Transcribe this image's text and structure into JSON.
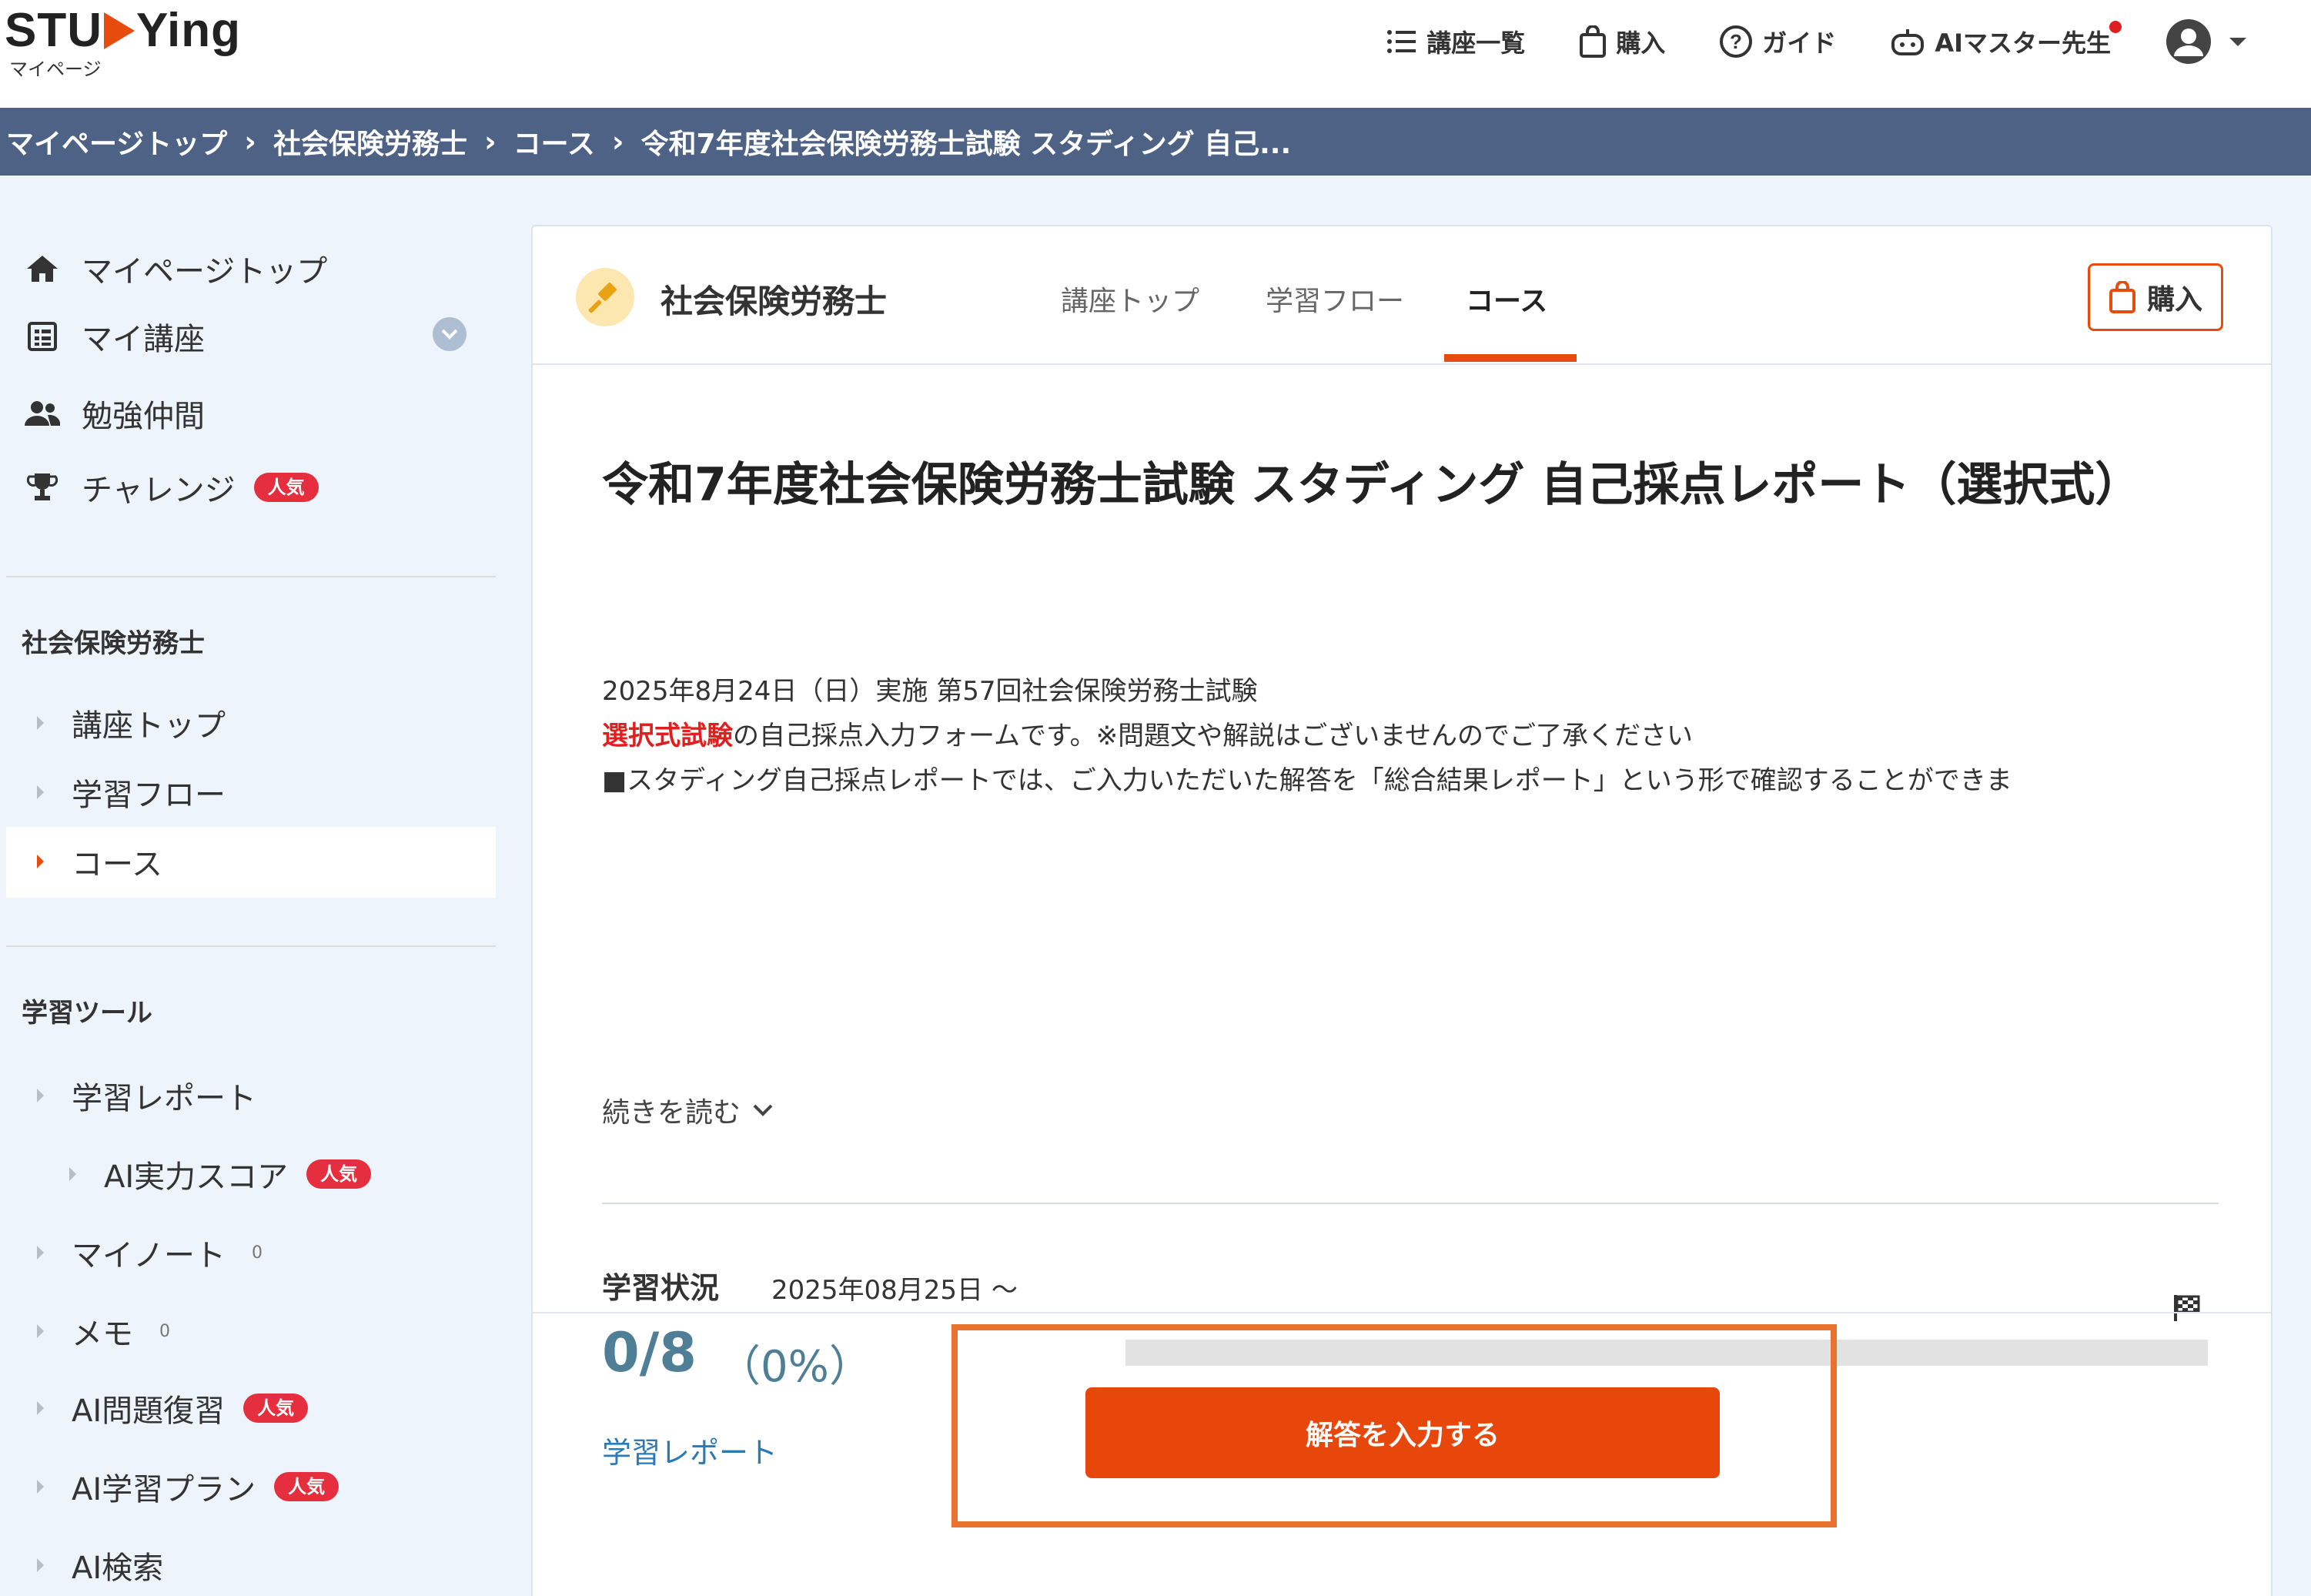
{
  "header": {
    "logo_text_left": "STU",
    "logo_text_right": "Ying",
    "logo_sub": "マイページ",
    "nav": [
      {
        "label": "講座一覧",
        "icon": "list-icon"
      },
      {
        "label": "購入",
        "icon": "shopping-bag-icon"
      },
      {
        "label": "ガイド",
        "icon": "help-circle-icon"
      },
      {
        "label": "AIマスター先生",
        "icon": "robot-icon"
      }
    ]
  },
  "breadcrumb": [
    "マイページトップ",
    "社会保険労務士",
    "コース",
    "令和7年度社会保険労務士試験 スタディング 自己..."
  ],
  "sidebar": {
    "top_items": [
      {
        "label": "マイページトップ",
        "icon": "home-icon"
      },
      {
        "label": "マイ講座",
        "icon": "book-icon"
      },
      {
        "label": "勉強仲間",
        "icon": "people-icon"
      },
      {
        "label": "チャレンジ",
        "icon": "trophy-icon",
        "badge": "人気"
      }
    ],
    "section1_heading": "社会保険労務士",
    "section1_items": [
      "講座トップ",
      "学習フロー",
      "コース"
    ],
    "section2_heading": "学習ツール",
    "section2_items": [
      {
        "label": "学習レポート"
      },
      {
        "label": "AI実力スコア",
        "badge": "人気"
      },
      {
        "label": "マイノート",
        "count": "0"
      },
      {
        "label": "メモ",
        "count": "0"
      },
      {
        "label": "AI問題復習",
        "badge": "人気"
      },
      {
        "label": "AI学習プラン",
        "badge": "人気"
      },
      {
        "label": "AI検索"
      }
    ]
  },
  "panel": {
    "course_name": "社会保険労務士",
    "tabs": [
      "講座トップ",
      "学習フロー",
      "コース"
    ],
    "active_tab": "コース",
    "buy_label": "購入",
    "title": "令和7年度社会保険労務士試験 スタディング 自己採点レポート（選択式）",
    "desc_line1": "2025年8月24日（日）実施 第57回社会保険労務士試験",
    "desc_line2_red": "選択式試験",
    "desc_line2_rest": "の自己採点入力フォームです。※問題文や解説はございませんのでご了承ください",
    "desc_line3": "■スタディング自己採点レポートでは、ご入力いただいた解答を「総合結果レポート」という形で確認することができま",
    "read_more": "続きを読む",
    "status_label": "学習状況",
    "status_date": "2025年08月25日 ～",
    "status_count": "0/8",
    "status_pct": "（0%）",
    "progress": 0,
    "report_link": "学習レポート",
    "answer_button": "解答を入力する"
  },
  "colors": {
    "accent": "#e84b0e",
    "breadcrumb_bg": "#4e6285",
    "badge": "#e52f3f",
    "status_text": "#4f7f97",
    "link": "#2a7ab8"
  }
}
